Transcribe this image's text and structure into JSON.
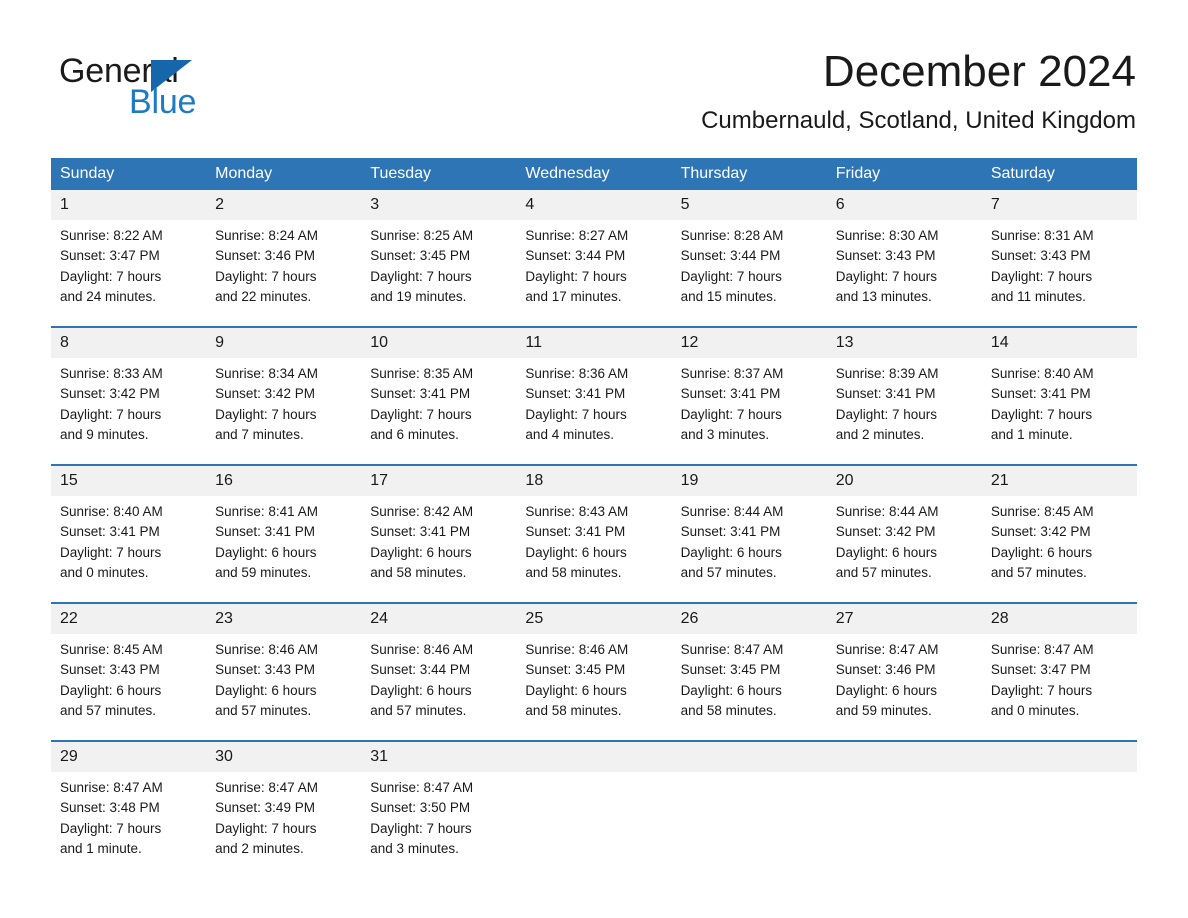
{
  "brand": {
    "name_part1": "General",
    "name_part2": "Blue"
  },
  "header": {
    "month_title": "December 2024",
    "location": "Cumbernauld, Scotland, United Kingdom"
  },
  "colors": {
    "header_blue": "#2e75b6",
    "logo_blue": "#1f7bc1",
    "daynum_band": "#f1f1f1",
    "text": "#1a1a1a"
  },
  "weekday_headers": [
    "Sunday",
    "Monday",
    "Tuesday",
    "Wednesday",
    "Thursday",
    "Friday",
    "Saturday"
  ],
  "weeks": [
    [
      {
        "day": "1",
        "sunrise": "Sunrise: 8:22 AM",
        "sunset": "Sunset: 3:47 PM",
        "daylight1": "Daylight: 7 hours",
        "daylight2": "and 24 minutes."
      },
      {
        "day": "2",
        "sunrise": "Sunrise: 8:24 AM",
        "sunset": "Sunset: 3:46 PM",
        "daylight1": "Daylight: 7 hours",
        "daylight2": "and 22 minutes."
      },
      {
        "day": "3",
        "sunrise": "Sunrise: 8:25 AM",
        "sunset": "Sunset: 3:45 PM",
        "daylight1": "Daylight: 7 hours",
        "daylight2": "and 19 minutes."
      },
      {
        "day": "4",
        "sunrise": "Sunrise: 8:27 AM",
        "sunset": "Sunset: 3:44 PM",
        "daylight1": "Daylight: 7 hours",
        "daylight2": "and 17 minutes."
      },
      {
        "day": "5",
        "sunrise": "Sunrise: 8:28 AM",
        "sunset": "Sunset: 3:44 PM",
        "daylight1": "Daylight: 7 hours",
        "daylight2": "and 15 minutes."
      },
      {
        "day": "6",
        "sunrise": "Sunrise: 8:30 AM",
        "sunset": "Sunset: 3:43 PM",
        "daylight1": "Daylight: 7 hours",
        "daylight2": "and 13 minutes."
      },
      {
        "day": "7",
        "sunrise": "Sunrise: 8:31 AM",
        "sunset": "Sunset: 3:43 PM",
        "daylight1": "Daylight: 7 hours",
        "daylight2": "and 11 minutes."
      }
    ],
    [
      {
        "day": "8",
        "sunrise": "Sunrise: 8:33 AM",
        "sunset": "Sunset: 3:42 PM",
        "daylight1": "Daylight: 7 hours",
        "daylight2": "and 9 minutes."
      },
      {
        "day": "9",
        "sunrise": "Sunrise: 8:34 AM",
        "sunset": "Sunset: 3:42 PM",
        "daylight1": "Daylight: 7 hours",
        "daylight2": "and 7 minutes."
      },
      {
        "day": "10",
        "sunrise": "Sunrise: 8:35 AM",
        "sunset": "Sunset: 3:41 PM",
        "daylight1": "Daylight: 7 hours",
        "daylight2": "and 6 minutes."
      },
      {
        "day": "11",
        "sunrise": "Sunrise: 8:36 AM",
        "sunset": "Sunset: 3:41 PM",
        "daylight1": "Daylight: 7 hours",
        "daylight2": "and 4 minutes."
      },
      {
        "day": "12",
        "sunrise": "Sunrise: 8:37 AM",
        "sunset": "Sunset: 3:41 PM",
        "daylight1": "Daylight: 7 hours",
        "daylight2": "and 3 minutes."
      },
      {
        "day": "13",
        "sunrise": "Sunrise: 8:39 AM",
        "sunset": "Sunset: 3:41 PM",
        "daylight1": "Daylight: 7 hours",
        "daylight2": "and 2 minutes."
      },
      {
        "day": "14",
        "sunrise": "Sunrise: 8:40 AM",
        "sunset": "Sunset: 3:41 PM",
        "daylight1": "Daylight: 7 hours",
        "daylight2": "and 1 minute."
      }
    ],
    [
      {
        "day": "15",
        "sunrise": "Sunrise: 8:40 AM",
        "sunset": "Sunset: 3:41 PM",
        "daylight1": "Daylight: 7 hours",
        "daylight2": "and 0 minutes."
      },
      {
        "day": "16",
        "sunrise": "Sunrise: 8:41 AM",
        "sunset": "Sunset: 3:41 PM",
        "daylight1": "Daylight: 6 hours",
        "daylight2": "and 59 minutes."
      },
      {
        "day": "17",
        "sunrise": "Sunrise: 8:42 AM",
        "sunset": "Sunset: 3:41 PM",
        "daylight1": "Daylight: 6 hours",
        "daylight2": "and 58 minutes."
      },
      {
        "day": "18",
        "sunrise": "Sunrise: 8:43 AM",
        "sunset": "Sunset: 3:41 PM",
        "daylight1": "Daylight: 6 hours",
        "daylight2": "and 58 minutes."
      },
      {
        "day": "19",
        "sunrise": "Sunrise: 8:44 AM",
        "sunset": "Sunset: 3:41 PM",
        "daylight1": "Daylight: 6 hours",
        "daylight2": "and 57 minutes."
      },
      {
        "day": "20",
        "sunrise": "Sunrise: 8:44 AM",
        "sunset": "Sunset: 3:42 PM",
        "daylight1": "Daylight: 6 hours",
        "daylight2": "and 57 minutes."
      },
      {
        "day": "21",
        "sunrise": "Sunrise: 8:45 AM",
        "sunset": "Sunset: 3:42 PM",
        "daylight1": "Daylight: 6 hours",
        "daylight2": "and 57 minutes."
      }
    ],
    [
      {
        "day": "22",
        "sunrise": "Sunrise: 8:45 AM",
        "sunset": "Sunset: 3:43 PM",
        "daylight1": "Daylight: 6 hours",
        "daylight2": "and 57 minutes."
      },
      {
        "day": "23",
        "sunrise": "Sunrise: 8:46 AM",
        "sunset": "Sunset: 3:43 PM",
        "daylight1": "Daylight: 6 hours",
        "daylight2": "and 57 minutes."
      },
      {
        "day": "24",
        "sunrise": "Sunrise: 8:46 AM",
        "sunset": "Sunset: 3:44 PM",
        "daylight1": "Daylight: 6 hours",
        "daylight2": "and 57 minutes."
      },
      {
        "day": "25",
        "sunrise": "Sunrise: 8:46 AM",
        "sunset": "Sunset: 3:45 PM",
        "daylight1": "Daylight: 6 hours",
        "daylight2": "and 58 minutes."
      },
      {
        "day": "26",
        "sunrise": "Sunrise: 8:47 AM",
        "sunset": "Sunset: 3:45 PM",
        "daylight1": "Daylight: 6 hours",
        "daylight2": "and 58 minutes."
      },
      {
        "day": "27",
        "sunrise": "Sunrise: 8:47 AM",
        "sunset": "Sunset: 3:46 PM",
        "daylight1": "Daylight: 6 hours",
        "daylight2": "and 59 minutes."
      },
      {
        "day": "28",
        "sunrise": "Sunrise: 8:47 AM",
        "sunset": "Sunset: 3:47 PM",
        "daylight1": "Daylight: 7 hours",
        "daylight2": "and 0 minutes."
      }
    ],
    [
      {
        "day": "29",
        "sunrise": "Sunrise: 8:47 AM",
        "sunset": "Sunset: 3:48 PM",
        "daylight1": "Daylight: 7 hours",
        "daylight2": "and 1 minute."
      },
      {
        "day": "30",
        "sunrise": "Sunrise: 8:47 AM",
        "sunset": "Sunset: 3:49 PM",
        "daylight1": "Daylight: 7 hours",
        "daylight2": "and 2 minutes."
      },
      {
        "day": "31",
        "sunrise": "Sunrise: 8:47 AM",
        "sunset": "Sunset: 3:50 PM",
        "daylight1": "Daylight: 7 hours",
        "daylight2": "and 3 minutes."
      },
      {
        "day": "",
        "sunrise": "",
        "sunset": "",
        "daylight1": "",
        "daylight2": ""
      },
      {
        "day": "",
        "sunrise": "",
        "sunset": "",
        "daylight1": "",
        "daylight2": ""
      },
      {
        "day": "",
        "sunrise": "",
        "sunset": "",
        "daylight1": "",
        "daylight2": ""
      },
      {
        "day": "",
        "sunrise": "",
        "sunset": "",
        "daylight1": "",
        "daylight2": ""
      }
    ]
  ]
}
